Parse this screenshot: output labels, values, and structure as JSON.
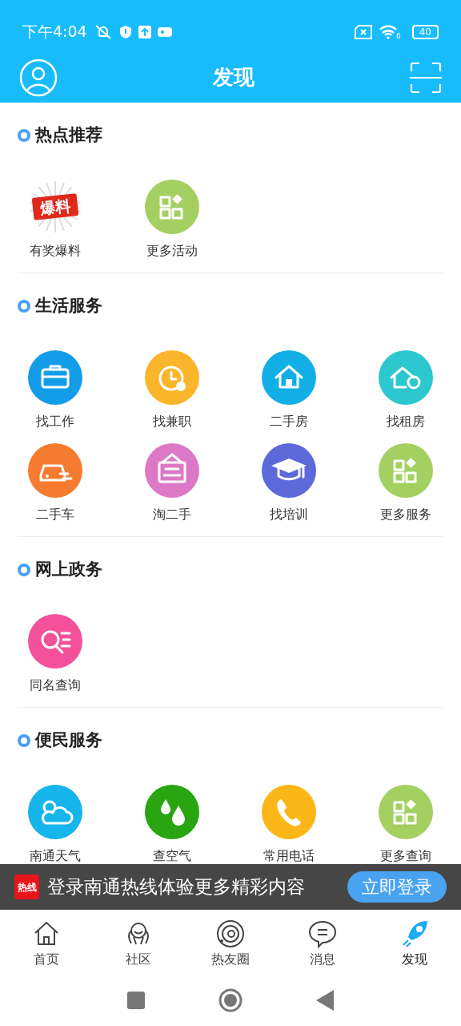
{
  "status_bar": {
    "time": "下午4:04",
    "wifi_badge": "6",
    "battery": "40"
  },
  "header": {
    "title": "发现"
  },
  "sections": [
    {
      "title": "热点推荐",
      "items": [
        {
          "label": "有奖爆料",
          "badge_text": "爆料"
        },
        {
          "label": "更多活动"
        }
      ]
    },
    {
      "title": "生活服务",
      "items": [
        {
          "label": "找工作"
        },
        {
          "label": "找兼职"
        },
        {
          "label": "二手房"
        },
        {
          "label": "找租房"
        },
        {
          "label": "二手车"
        },
        {
          "label": "淘二手"
        },
        {
          "label": "找培训"
        },
        {
          "label": "更多服务"
        }
      ]
    },
    {
      "title": "网上政务",
      "items": [
        {
          "label": "同名查询"
        }
      ]
    },
    {
      "title": "便民服务",
      "items": [
        {
          "label": "南通天气"
        },
        {
          "label": "查空气"
        },
        {
          "label": "常用电话"
        },
        {
          "label": "更多查询"
        }
      ]
    }
  ],
  "login_banner": {
    "logo_text": "热线",
    "message": "登录南通热线体验更多精彩内容",
    "button": "立即登录"
  },
  "tabs": [
    {
      "label": "首页",
      "selected": false
    },
    {
      "label": "社区",
      "selected": false
    },
    {
      "label": "热友圈",
      "selected": false
    },
    {
      "label": "消息",
      "selected": false
    },
    {
      "label": "发现",
      "selected": true
    }
  ]
}
